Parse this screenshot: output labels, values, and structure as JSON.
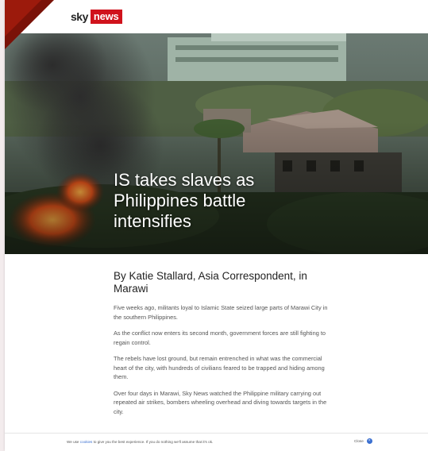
{
  "brand": {
    "sky": "sky",
    "news": "news"
  },
  "hero": {
    "headline": "IS takes slaves as Philippines battle intensifies"
  },
  "article": {
    "byline": "By Katie Stallard, Asia Correspondent, in Marawi",
    "paragraphs": [
      "Five weeks ago, militants loyal to Islamic State seized large parts of Marawi City in the southern Philippines.",
      "As the conflict now enters its second month, government forces are still fighting to regain control.",
      "The rebels have lost ground, but remain entrenched in what was the commercial heart of the city, with hundreds of civilians feared to be trapped and hiding among them.",
      "Over four days in Marawi, Sky News watched the Philippine military carrying out repeated air strikes, bombers wheeling overhead and diving towards targets in the city."
    ]
  },
  "cookie": {
    "prefix": "We use ",
    "link": "cookies",
    "suffix": " to give you the best experience. If you do nothing we'll assume that it's ok.",
    "close_label": "Close",
    "close_icon": "×"
  },
  "colors": {
    "brand_red": "#d0121c",
    "link_blue": "#3a6fd0",
    "corner_red": "#9c1a0c"
  }
}
